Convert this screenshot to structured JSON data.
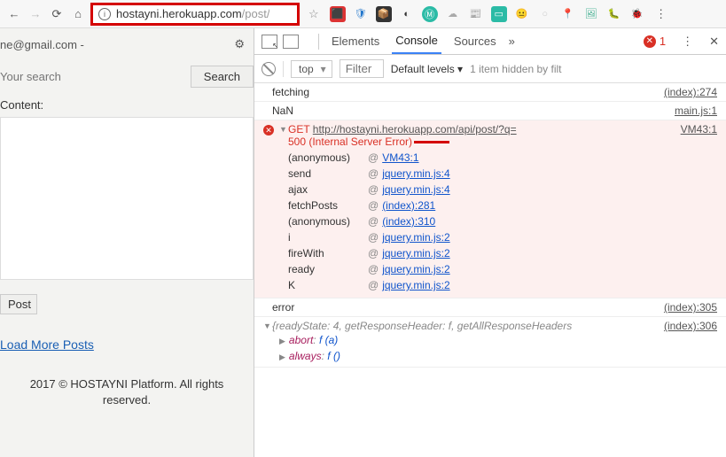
{
  "address": {
    "secure_icon": "i",
    "host": "hostayni.herokuapp.com",
    "path": "/post/"
  },
  "toolbar_icons": [
    "⬛",
    "🛡",
    "📦",
    "◐",
    "Ⓜ",
    "☁",
    "📰",
    "▭",
    "😐",
    "○",
    "📍",
    "🖼",
    "🐛",
    "🐞"
  ],
  "page": {
    "email": "ne@gmail.com -",
    "search_placeholder": "Your search",
    "search_btn": "Search",
    "content_label": "Content:",
    "post_btn": "Post",
    "load_more": "Load More Posts",
    "footer_line1": "2017 © HOSTAYNI Platform. All rights",
    "footer_line2": "reserved."
  },
  "devtools": {
    "tabs": [
      "Elements",
      "Console",
      "Sources"
    ],
    "active_tab": 1,
    "error_count": "1",
    "context": "top",
    "filter_placeholder": "Filter",
    "levels": "Default levels ▾",
    "hidden": "1 item hidden by filt",
    "logs": [
      {
        "msg": "fetching",
        "src": "(index):274"
      },
      {
        "msg": "NaN",
        "src": "main.js:1"
      }
    ],
    "error": {
      "method": "GET",
      "url": "http://hostayni.herokuapp.com/api/post/?q=",
      "status": "500 (Internal Server Error)",
      "src": "VM43:1",
      "stack": [
        {
          "fn": "(anonymous)",
          "lnk": "VM43:1"
        },
        {
          "fn": "send",
          "lnk": "jquery.min.js:4"
        },
        {
          "fn": "ajax",
          "lnk": "jquery.min.js:4"
        },
        {
          "fn": "fetchPosts",
          "lnk": "(index):281"
        },
        {
          "fn": "(anonymous)",
          "lnk": "(index):310"
        },
        {
          "fn": "i",
          "lnk": "jquery.min.js:2"
        },
        {
          "fn": "fireWith",
          "lnk": "jquery.min.js:2"
        },
        {
          "fn": "ready",
          "lnk": "jquery.min.js:2"
        },
        {
          "fn": "K",
          "lnk": "jquery.min.js:2"
        }
      ]
    },
    "logs2": [
      {
        "msg": "error",
        "src": "(index):305"
      },
      {
        "msg": "",
        "src": "(index):306"
      }
    ],
    "obj": {
      "head": "{readyState: 4, getResponseHeader: f, getAllResponseHeaders",
      "rows": [
        {
          "k": "abort",
          "v": "f (a)"
        },
        {
          "k": "always",
          "v": "f ()"
        }
      ]
    }
  }
}
